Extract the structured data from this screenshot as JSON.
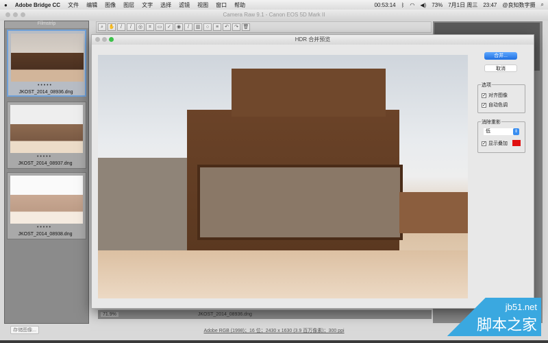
{
  "menubar": {
    "app": "Adobe Bridge CC",
    "items": [
      "文件",
      "编辑",
      "图像",
      "图层",
      "文字",
      "选择",
      "滤镜",
      "视图",
      "窗口",
      "帮助"
    ],
    "timer": "00:53:14",
    "battery": "73%",
    "date": "7月1日 周三",
    "time": "23:47",
    "user": "@良知数字摄"
  },
  "window": {
    "title": "Camera Raw 9.1 - Canon EOS 5D Mark II"
  },
  "filmstrip": {
    "header": "Filmstrip",
    "items": [
      {
        "name": "JKOST_2014_08936.dng",
        "dots": "• • • • •"
      },
      {
        "name": "JKOST_2014_08937.dng",
        "dots": "• • • • •"
      },
      {
        "name": "JKOST_2014_08938.dng",
        "dots": "• • • • •"
      }
    ]
  },
  "dialog": {
    "title": "HDR 合并预览",
    "merge": "合并...",
    "cancel": "取消",
    "options_title": "选项",
    "align": "对齐图像",
    "auto_tone": "自动色调",
    "deghost_title": "消除重影",
    "deghost_value": "低",
    "show_overlay": "显示叠加",
    "overlay_color": "#e01010"
  },
  "bottombar": {
    "zoom": "71.9%",
    "filename": "JKOST_2014_08936.dng"
  },
  "footer": {
    "save": "存储图像...",
    "info": "Adobe RGB (1998)；16 位；2430 x 1630 (3.9 百万像素)；300 ppi"
  },
  "watermark": {
    "site": "jb51.net",
    "name": "脚本之家"
  }
}
